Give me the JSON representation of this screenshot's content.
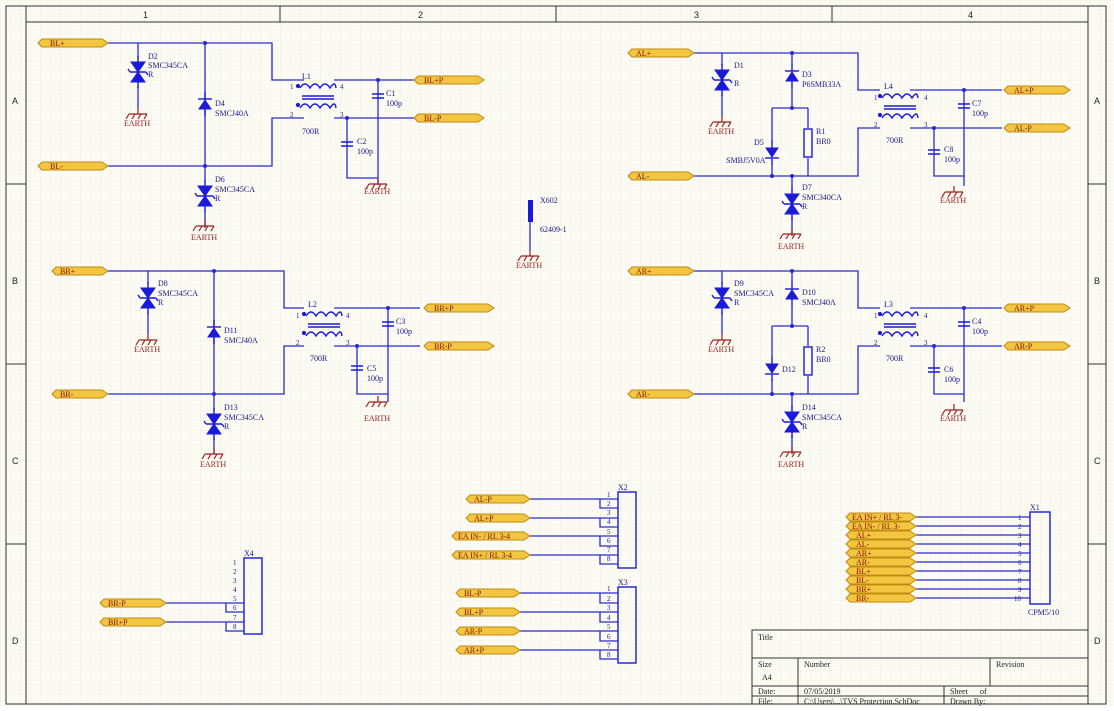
{
  "zones": {
    "columns": [
      "1",
      "2",
      "3",
      "4"
    ],
    "rows": [
      "A",
      "B",
      "C",
      "D"
    ]
  },
  "earth_label": "EARTH",
  "blocks": [
    {
      "id": "BL",
      "ports": {
        "plus_in": "BL+",
        "minus_in": "BL-",
        "plus_out": "BL+P",
        "minus_out": "BL-P"
      },
      "tvs_top": {
        "ref": "D2",
        "value": "SMC345CA",
        "suffix": "R"
      },
      "tvs_mid": {
        "ref": "D4",
        "value": "SMCJ40A"
      },
      "tvs_bot": {
        "ref": "D6",
        "value": "SMC345CA",
        "suffix": "R"
      },
      "choke": {
        "ref": "L1",
        "value": "700R",
        "pins": [
          "1",
          "2",
          "3",
          "4"
        ]
      },
      "cap_top": {
        "ref": "C1",
        "value": "100p"
      },
      "cap_bot": {
        "ref": "C2",
        "value": "100p"
      }
    },
    {
      "id": "BR",
      "ports": {
        "plus_in": "BR+",
        "minus_in": "BR-",
        "plus_out": "BR+P",
        "minus_out": "BR-P"
      },
      "tvs_top": {
        "ref": "D8",
        "value": "SMC345CA",
        "suffix": "R"
      },
      "tvs_mid": {
        "ref": "D11",
        "value": "SMCJ40A"
      },
      "tvs_bot": {
        "ref": "D13",
        "value": "SMC345CA",
        "suffix": "R"
      },
      "choke": {
        "ref": "L2",
        "value": "700R",
        "pins": [
          "1",
          "2",
          "3",
          "4"
        ]
      },
      "cap_top": {
        "ref": "C3",
        "value": "100p"
      },
      "cap_bot": {
        "ref": "C5",
        "value": "100p"
      }
    },
    {
      "id": "AL",
      "ports": {
        "plus_in": "AL+",
        "minus_in": "AL-",
        "plus_out": "AL+P",
        "minus_out": "AL-P"
      },
      "tvs_top": {
        "ref": "D1",
        "value": "",
        "suffix": "R"
      },
      "tvs_mid": {
        "ref": "D3",
        "value": "P6SMB33A"
      },
      "zener": {
        "ref": "D5",
        "value": "SMBJ5V0A"
      },
      "res": {
        "ref": "R1",
        "value": "BR0"
      },
      "tvs_bot": {
        "ref": "D7",
        "value": "SMC340CA",
        "suffix": "R"
      },
      "choke": {
        "ref": "L4",
        "value": "700R",
        "pins": [
          "1",
          "2",
          "3",
          "4"
        ]
      },
      "cap_top": {
        "ref": "C7",
        "value": "100p"
      },
      "cap_bot": {
        "ref": "C8",
        "value": "100p"
      }
    },
    {
      "id": "AR",
      "ports": {
        "plus_in": "AR+",
        "minus_in": "AR-",
        "plus_out": "AR+P",
        "minus_out": "AR-P"
      },
      "tvs_top": {
        "ref": "D9",
        "value": "SMC345CA",
        "suffix": "R"
      },
      "tvs_mid": {
        "ref": "D10",
        "value": "SMCJ40A"
      },
      "zener": {
        "ref": "D12",
        "value": ""
      },
      "res": {
        "ref": "R2",
        "value": "BR0"
      },
      "tvs_bot": {
        "ref": "D14",
        "value": "SMC345CA",
        "suffix": "R"
      },
      "choke": {
        "ref": "L3",
        "value": "700R",
        "pins": [
          "1",
          "2",
          "3",
          "4"
        ]
      },
      "cap_top": {
        "ref": "C4",
        "value": "100p"
      },
      "cap_bot": {
        "ref": "C6",
        "value": "100p"
      }
    }
  ],
  "x602": {
    "ref": "X602",
    "value": "62409-1"
  },
  "connectors": {
    "X2": {
      "ref": "X2",
      "pins": [
        "1",
        "2",
        "3",
        "4",
        "5",
        "6",
        "7",
        "8"
      ],
      "nets": [
        "AL-P",
        "AL+P",
        "EA IN- / RL 3-4",
        "EA IN+ / RL 3-4"
      ]
    },
    "X3": {
      "ref": "X3",
      "pins": [
        "1",
        "2",
        "3",
        "4",
        "5",
        "6",
        "7",
        "8"
      ],
      "nets": [
        "BL-P",
        "BL+P",
        "AR-P",
        "AR+P"
      ]
    },
    "X4": {
      "ref": "X4",
      "pins": [
        "1",
        "2",
        "3",
        "4",
        "5",
        "6",
        "7",
        "8"
      ],
      "nets": [
        "BR-P",
        "BR+P"
      ]
    },
    "X1": {
      "ref": "X1",
      "value": "CPM5/10",
      "pins": [
        "1",
        "2",
        "3",
        "4",
        "5",
        "6",
        "7",
        "8",
        "9",
        "10"
      ],
      "nets": [
        "EA IN+ / RL 3-",
        "EA IN- / RL 3-",
        "AL+",
        "AL-",
        "AR+",
        "AR-",
        "BL+",
        "BL-",
        "BR+",
        "BR-"
      ]
    }
  },
  "title_block": {
    "title_label": "Title",
    "size_label": "Size",
    "size_value": "A4",
    "number_label": "Number",
    "revision_label": "Revision",
    "date_label": "Date:",
    "date_value": "07/05/2019",
    "file_label": "File:",
    "file_value": "C:\\Users\\...\\TVS Protection.SchDoc",
    "sheet_label": "Sheet",
    "of_label": "of",
    "drawn_label": "Drawn By:"
  }
}
